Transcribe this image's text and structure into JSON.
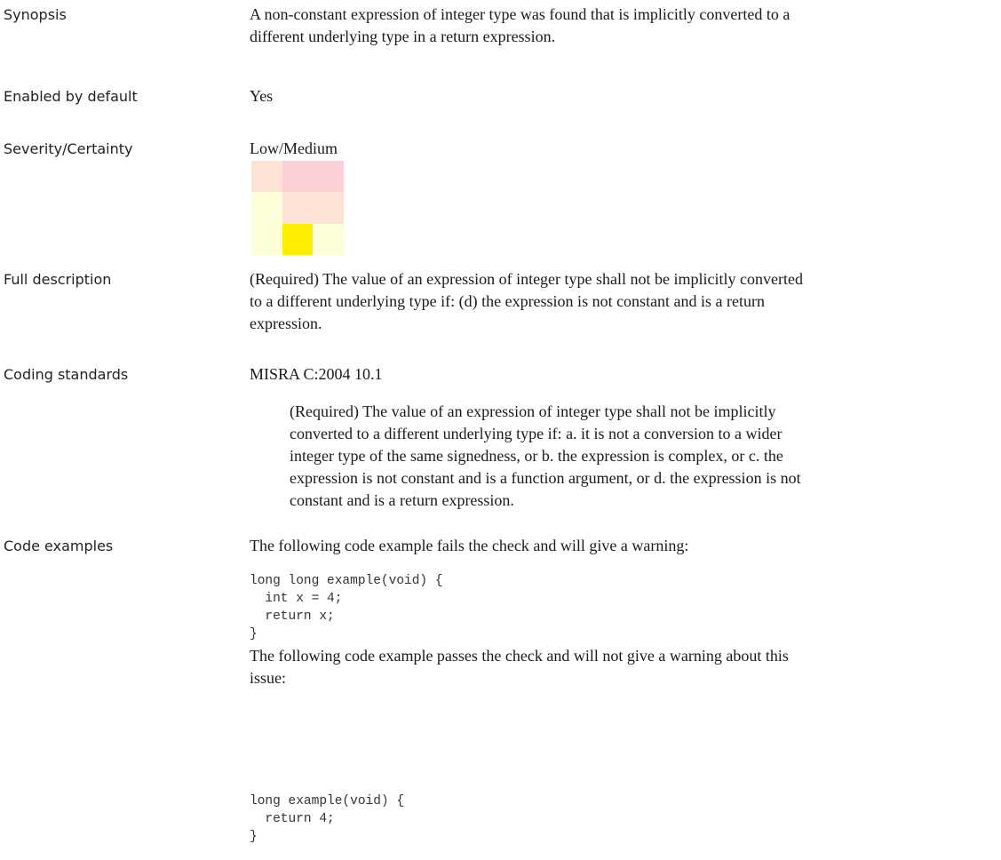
{
  "rows": {
    "synopsis": {
      "label": "Synopsis",
      "lines": [
        "A non-constant expression of integer type was found that is implicitly converted to a",
        "different underlying type in a return expression."
      ]
    },
    "enabled": {
      "label": "Enabled by default",
      "value": "Yes"
    },
    "severity": {
      "label": "Severity/Certainty",
      "value": "Low/Medium",
      "matrix": {
        "level": "Low/Medium",
        "colors": [
          [
            "#fde3d5",
            "#fcd0d6",
            "#fcd0d6"
          ],
          [
            "#fefed8",
            "#fde3d5",
            "#fde3d5"
          ],
          [
            "#fefed8",
            "#ffee00",
            "#fefed8"
          ]
        ],
        "highlighted_cell": "row 3, column 2"
      }
    },
    "full_description": {
      "label": "Full description",
      "lines": [
        "(Required) The value of an expression of integer type shall not be implicitly converted",
        "to a different underlying type if: (d) the expression is not constant and is a return",
        "expression."
      ]
    },
    "coding_standards": {
      "label": "Coding standards",
      "standard": "MISRA C:2004 10.1",
      "lines": [
        "(Required) The value of an expression of integer type shall not be implicitly",
        "converted to a different underlying type if: a. it is not a conversion to a wider",
        "integer type of the same signedness, or b. the expression is complex, or c. the",
        "expression is not constant and is a function argument, or d. the expression is not",
        "constant and is a return expression."
      ]
    },
    "code_examples": {
      "label": "Code examples",
      "fail_intro": "The following code example fails the check and will give a warning:",
      "fail_code": [
        "long long example(void) {",
        "  int x = 4;",
        "  return x;",
        "}"
      ],
      "pass_intro_lines": [
        "The following code example passes the check and will not give a warning about this",
        "issue:"
      ],
      "pass_code": [
        "long example(void) {",
        "  return 4;",
        "}"
      ]
    }
  }
}
